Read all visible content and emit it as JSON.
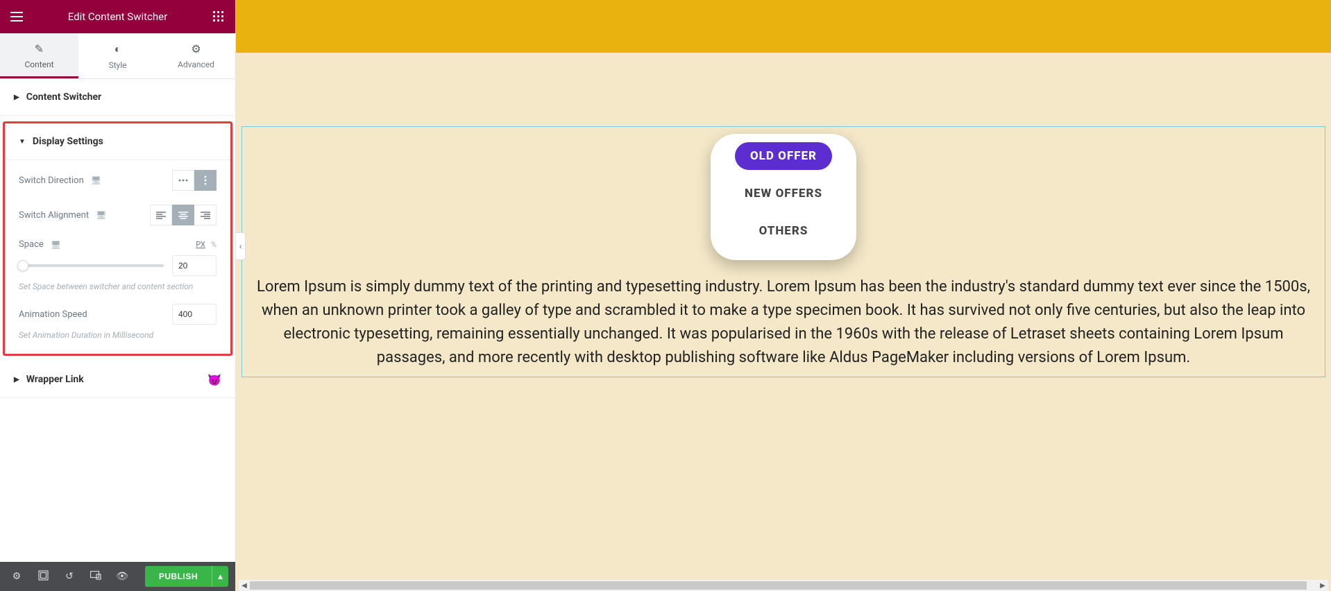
{
  "header": {
    "title": "Edit Content Switcher"
  },
  "tabs": {
    "content": "Content",
    "style": "Style",
    "advanced": "Advanced"
  },
  "sections": {
    "content_switcher": "Content Switcher",
    "display_settings": "Display Settings",
    "wrapper_link": "Wrapper Link"
  },
  "controls": {
    "switch_direction": "Switch Direction",
    "switch_alignment": "Switch Alignment",
    "space": "Space",
    "space_value": "20",
    "space_hint": "Set Space between switcher and content section",
    "unit_px": "PX",
    "unit_pct": "%",
    "anim_speed": "Animation Speed",
    "anim_value": "400",
    "anim_hint": "Set Animation Duration in Millisecond"
  },
  "footer": {
    "publish": "PUBLISH"
  },
  "preview": {
    "tabs": {
      "old": "OLD OFFER",
      "new": "NEW OFFERS",
      "others": "OTHERS"
    },
    "body": "Lorem Ipsum is simply dummy text of the printing and typesetting industry. Lorem Ipsum has been the industry's standard dummy text ever since the 1500s, when an unknown printer took a galley of type and scrambled it to make a type specimen book. It has survived not only five centuries, but also the leap into electronic typesetting, remaining essentially unchanged. It was popularised in the 1960s with the release of Letraset sheets containing Lorem Ipsum passages, and more recently with desktop publishing software like Aldus PageMaker including versions of Lorem Ipsum."
  }
}
